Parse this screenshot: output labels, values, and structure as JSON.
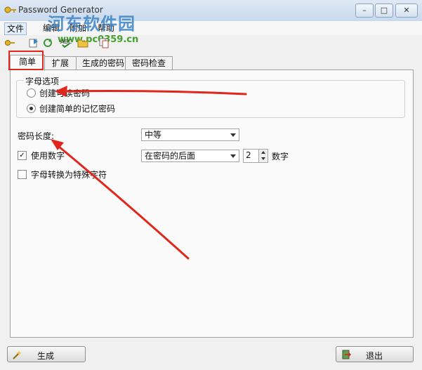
{
  "window": {
    "title": "Password Generator",
    "watermark_text": "河东软件园",
    "watermark_url": "www.pc0359.cn",
    "controls": {
      "minimize": "–",
      "maximize": "□",
      "close": "✕"
    }
  },
  "menu": {
    "items": [
      {
        "label": "文件"
      },
      {
        "label": "编辑"
      },
      {
        "label": "附加"
      },
      {
        "label": "帮助"
      }
    ]
  },
  "toolbar": {
    "icons": [
      "key-icon",
      "export-icon",
      "refresh-icon",
      "spellcheck-icon",
      "folder-icon",
      "copy-icon"
    ]
  },
  "tabs": [
    {
      "label": "简单",
      "selected": true
    },
    {
      "label": "扩展"
    },
    {
      "label": "生成的密码"
    },
    {
      "label": "密码检查"
    }
  ],
  "simple": {
    "group_title": "字母选项",
    "radio_pronounceable": "创建可读密码",
    "radio_memorable": "创建简单的记忆密码",
    "selected_radio": "memorable",
    "length_label": "密码长度:",
    "length_value": "中等",
    "use_numbers_label": "使用数字",
    "use_numbers_checked": true,
    "number_position": "在密码的后面",
    "number_count": "2",
    "number_unit": "数字",
    "special_chars_label": "字母转换为特殊字符",
    "special_chars_checked": false
  },
  "buttons": {
    "generate": "生成",
    "exit": "退出"
  },
  "colors": {
    "annotation_red": "#e1261c",
    "watermark_blue": "#3a84c8",
    "watermark_green": "#42a02c"
  }
}
